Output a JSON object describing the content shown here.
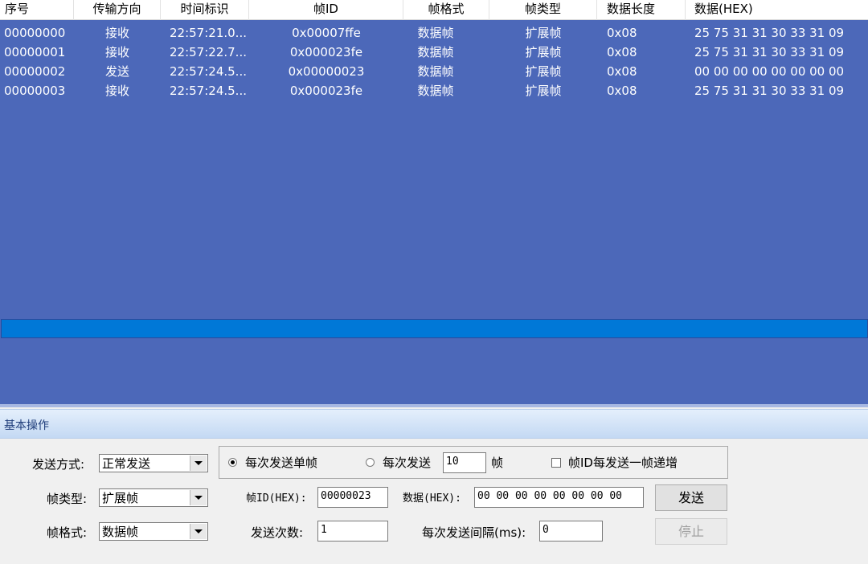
{
  "table": {
    "columns": [
      "序号",
      "传输方向",
      "时间标识",
      "帧ID",
      "帧格式",
      "帧类型",
      "数据长度",
      "数据(HEX)"
    ],
    "rows": [
      [
        "00000000",
        "接收",
        "22:57:21.0...",
        "0x00007ffe",
        "数据帧",
        "扩展帧",
        "0x08",
        "25 75 31 31 30 33 31 09"
      ],
      [
        "00000001",
        "接收",
        "22:57:22.7...",
        "0x000023fe",
        "数据帧",
        "扩展帧",
        "0x08",
        "25 75 31 31 30 33 31 09"
      ],
      [
        "00000002",
        "发送",
        "22:57:24.5...",
        "0x00000023",
        "数据帧",
        "扩展帧",
        "0x08",
        "00 00 00 00 00 00 00 00"
      ],
      [
        "00000003",
        "接收",
        "22:57:24.5...",
        "0x000023fe",
        "数据帧",
        "扩展帧",
        "0x08",
        "25 75 31 31 30 33 31 09"
      ]
    ]
  },
  "panel": {
    "title": "基本操作",
    "send_mode_label": "发送方式:",
    "send_mode_value": "正常发送",
    "frame_type_label": "帧类型:",
    "frame_type_value": "扩展帧",
    "frame_format_label": "帧格式:",
    "frame_format_value": "数据帧",
    "radio_single_label": "每次发送单帧",
    "radio_multi_label": "每次发送",
    "multi_count": "10",
    "multi_unit": "帧",
    "increment_label": "帧ID每发送一帧递增",
    "frame_id_label": "帧ID(HEX):",
    "frame_id_value": "00000023",
    "data_label": "数据(HEX):",
    "data_value": "00 00 00 00 00 00 00 00",
    "send_button": "发送",
    "send_count_label": "发送次数:",
    "send_count_value": "1",
    "interval_label": "每次发送间隔(ms):",
    "interval_value": "0",
    "stop_button": "停止"
  },
  "colors": {
    "list_bg": "#4c68b9",
    "selection_bar": "#0078d7"
  }
}
